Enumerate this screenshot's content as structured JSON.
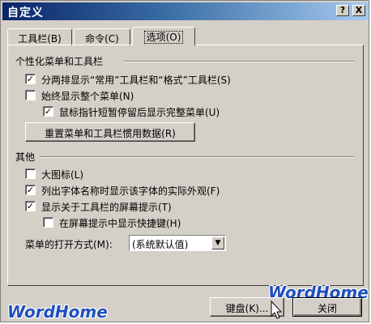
{
  "window": {
    "title": "自定义",
    "help_icon": "?",
    "close_icon": "X"
  },
  "tabs": [
    {
      "label": "工具栏(B)"
    },
    {
      "label": "命令(C)"
    },
    {
      "label": "选项(O)"
    }
  ],
  "section_personalized": {
    "heading": "个性化菜单和工具栏",
    "opt_two_rows": {
      "label": "分两排显示“常用”工具栏和“格式”工具栏(S)",
      "checked": true
    },
    "opt_full_menus": {
      "label": "始终显示整个菜单(N)",
      "checked": false
    },
    "opt_full_after_delay": {
      "label": "鼠标指针短暂停留后显示完整菜单(U)",
      "checked": true
    },
    "reset_button": "重置菜单和工具栏惯用数据(R)"
  },
  "section_other": {
    "heading": "其他",
    "opt_large_icons": {
      "label": "大图标(L)",
      "checked": false
    },
    "opt_font_names": {
      "label": "列出字体名称时显示该字体的实际外观(F)",
      "checked": true
    },
    "opt_screentips": {
      "label": "显示关于工具栏的屏幕提示(T)",
      "checked": true
    },
    "opt_shortcut_keys": {
      "label": "在屏幕提示中显示快捷键(H)",
      "checked": false
    },
    "animation_label": "菜单的打开方式(M):",
    "animation_value": "(系统默认值)"
  },
  "footer": {
    "keyboard_button": "键盘(K)...",
    "close_button": "关闭"
  },
  "watermarks": {
    "right": "WordHome",
    "left": "WordHome"
  },
  "colors": {
    "dialog_bg": "#d4d0c8",
    "title_start": "#0a246a",
    "title_end": "#a6caf0",
    "watermark": "#1f4fbf"
  }
}
